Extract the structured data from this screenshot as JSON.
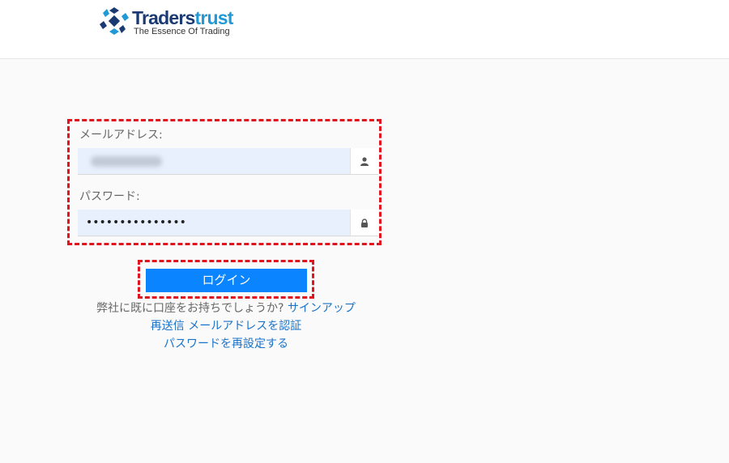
{
  "brand": {
    "name_part1": "Traders",
    "name_part2": "trust",
    "tagline": "The Essence Of Trading",
    "colors": {
      "primary": "#1b3a73",
      "accent": "#1f9ad6"
    }
  },
  "form": {
    "email_label": "メールアドレス:",
    "email_icon": "user-icon",
    "password_label": "パスワード:",
    "password_value": "•••••••••••••••",
    "password_icon": "lock-icon",
    "highlight_color": "#e0131e"
  },
  "login_button": {
    "label": "ログイン",
    "color": "#0a84ff"
  },
  "links": {
    "signup_prompt": "弊社に既に口座をお持ちでしょうか?",
    "signup_link": "サインアップ",
    "resend_link": "再送信 メールアドレスを認証",
    "reset_password_link": "パスワードを再設定する"
  }
}
